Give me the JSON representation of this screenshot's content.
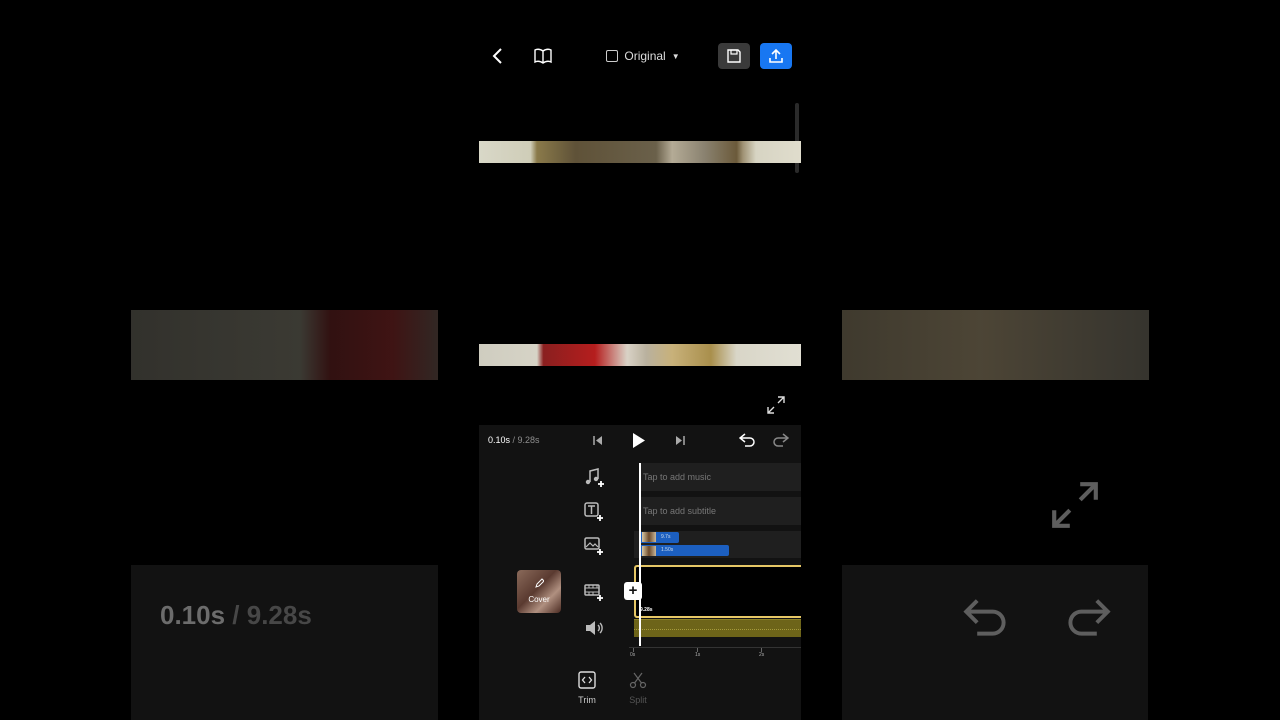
{
  "header": {
    "aspect_label": "Original"
  },
  "player": {
    "current_time": "0.10s",
    "total_time": " / 9.28s"
  },
  "tracks": {
    "music_placeholder": "Tap to add music",
    "subtitle_placeholder": "Tap to add subtitle",
    "overlay_clip_1": "9.7s",
    "overlay_clip_2": "1.50s",
    "main_clip_duration": "9.28s"
  },
  "cover": {
    "label": "Cover"
  },
  "ruler": {
    "labels": [
      "0s",
      "1s",
      "2s"
    ]
  },
  "tools": [
    {
      "label": "Trim",
      "icon": "trim-icon",
      "enabled": true
    },
    {
      "label": "Split",
      "icon": "scissors-icon",
      "enabled": false
    }
  ],
  "colors": {
    "accent": "#1877f2",
    "clip_border": "#e6c766",
    "audio_track": "#6d6419",
    "overlay_clip": "#1c5fc0"
  }
}
